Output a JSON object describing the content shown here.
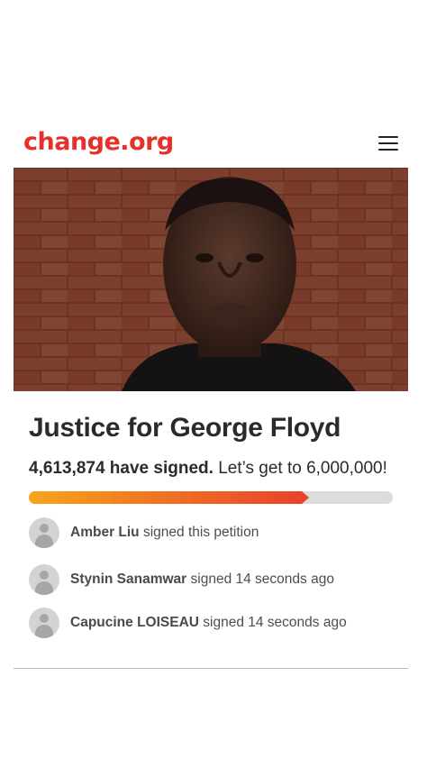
{
  "header": {
    "logo_text": "change.org",
    "logo_color": "#e4312b",
    "menu_icon": "hamburger-menu-icon"
  },
  "petition": {
    "title": "Justice for George Floyd",
    "signature_count": "4,613,874 have signed.",
    "goal_text": "Let’s get to 6,000,000!",
    "progress_fraction": 0.77
  },
  "recent_signers": [
    {
      "name": "Amber Liu",
      "action": "signed this petition"
    },
    {
      "name": "Stynin Sanamwar",
      "action": "signed 14 seconds ago"
    },
    {
      "name": "Capucine LOISEAU",
      "action": "signed 14 seconds ago"
    }
  ]
}
